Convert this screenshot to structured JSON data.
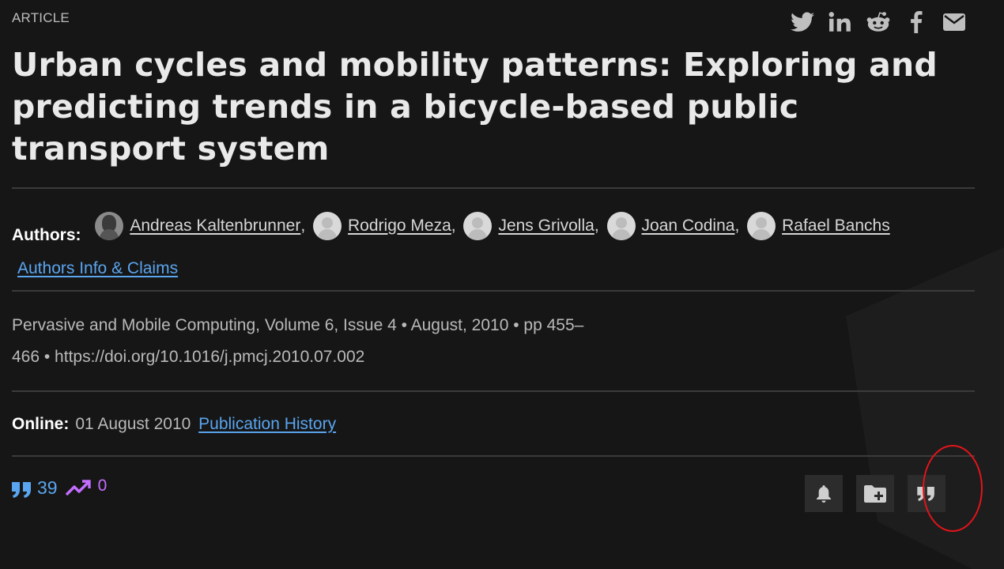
{
  "article": {
    "type_label": "ARTICLE",
    "title": "Urban cycles and mobility patterns: Exploring and predicting trends in a bicycle-based public transport system"
  },
  "share": {
    "icons": [
      "twitter-icon",
      "linkedin-icon",
      "reddit-icon",
      "facebook-icon",
      "email-icon"
    ]
  },
  "authors": {
    "label": "Authors:",
    "list": [
      {
        "name": "Andreas Kaltenbrunner",
        "sep": ",",
        "avatar": "photo"
      },
      {
        "name": "Rodrigo Meza",
        "sep": ",",
        "avatar": "placeholder"
      },
      {
        "name": "Jens Grivolla",
        "sep": ",",
        "avatar": "placeholder"
      },
      {
        "name": "Joan Codina",
        "sep": ",",
        "avatar": "placeholder"
      },
      {
        "name": "Rafael Banchs",
        "sep": "",
        "avatar": "placeholder"
      }
    ],
    "info_link": "Authors Info & Claims"
  },
  "publication": {
    "line1": "Pervasive and Mobile Computing, Volume 6, Issue 4 • August, 2010  • pp 455–",
    "line2": "466 • https://doi.org/10.1016/j.pmcj.2010.07.002"
  },
  "online": {
    "label": "Online:",
    "date": "01 August 2010",
    "history_link": "Publication History"
  },
  "metrics": {
    "citations": "39",
    "altmetric": "0"
  },
  "actions": {
    "icons": [
      "bell-icon",
      "folder-add-icon",
      "quote-icon"
    ]
  },
  "colors": {
    "background": "#161616",
    "link": "#5aa5ef",
    "altmetric": "#c46eff",
    "highlight": "#e4141b"
  }
}
